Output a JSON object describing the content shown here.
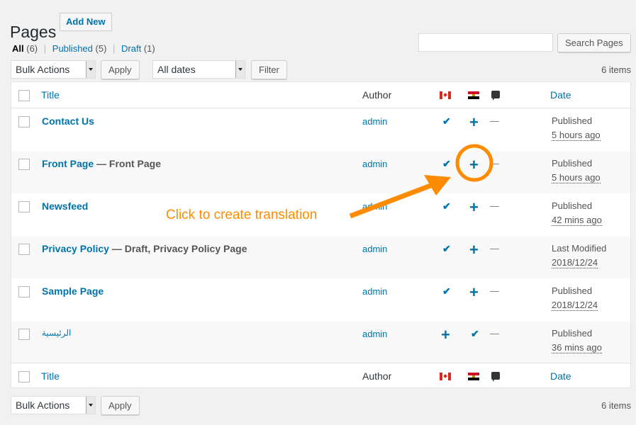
{
  "header": {
    "title": "Pages",
    "add_new_label": "Add New"
  },
  "filters": [
    {
      "label": "All",
      "count": "(6)",
      "current": true
    },
    {
      "label": "Published",
      "count": "(5)",
      "current": false
    },
    {
      "label": "Draft",
      "count": "(1)",
      "current": false
    }
  ],
  "separator": "|",
  "search": {
    "value": "",
    "button_label": "Search Pages"
  },
  "top_actions": {
    "bulk_label": "Bulk Actions",
    "apply_label": "Apply",
    "dates_label": "All dates",
    "filter_label": "Filter",
    "items_count": "6 items"
  },
  "bottom_actions": {
    "bulk_label": "Bulk Actions",
    "apply_label": "Apply",
    "items_count": "6 items"
  },
  "columns": {
    "title": "Title",
    "author": "Author",
    "lang1": "canada-flag-icon",
    "lang2": "egypt-flag-icon",
    "comments": "comment-icon",
    "date": "Date"
  },
  "rows": [
    {
      "title": "Contact Us",
      "state": "",
      "author": "admin",
      "lang1": "check",
      "lang2": "plus",
      "comments": "—",
      "status": "Published",
      "date": "5 hours ago"
    },
    {
      "title": "Front Page",
      "state": " — Front Page",
      "author": "admin",
      "lang1": "check",
      "lang2": "plus",
      "comments": "—",
      "status": "Published",
      "date": "5 hours ago"
    },
    {
      "title": "Newsfeed",
      "state": "",
      "author": "admin",
      "lang1": "check",
      "lang2": "plus",
      "comments": "—",
      "status": "Published",
      "date": "42 mins ago"
    },
    {
      "title": "Privacy Policy",
      "state": " — Draft, Privacy Policy Page",
      "author": "admin",
      "lang1": "check",
      "lang2": "plus",
      "comments": "—",
      "status": "Last Modified",
      "date": "2018/12/24"
    },
    {
      "title": "Sample Page",
      "state": "",
      "author": "admin",
      "lang1": "check",
      "lang2": "plus",
      "comments": "—",
      "status": "Published",
      "date": "2018/12/24"
    },
    {
      "title": "الرئيسية",
      "state": "",
      "author": "admin",
      "lang1": "plus",
      "lang2": "check",
      "comments": "—",
      "status": "Published",
      "date": "36 mins ago"
    }
  ],
  "icons": {
    "check": "✔",
    "plus": "+"
  },
  "annotation": {
    "text": "Click to create translation",
    "color": "#ff8c00"
  }
}
